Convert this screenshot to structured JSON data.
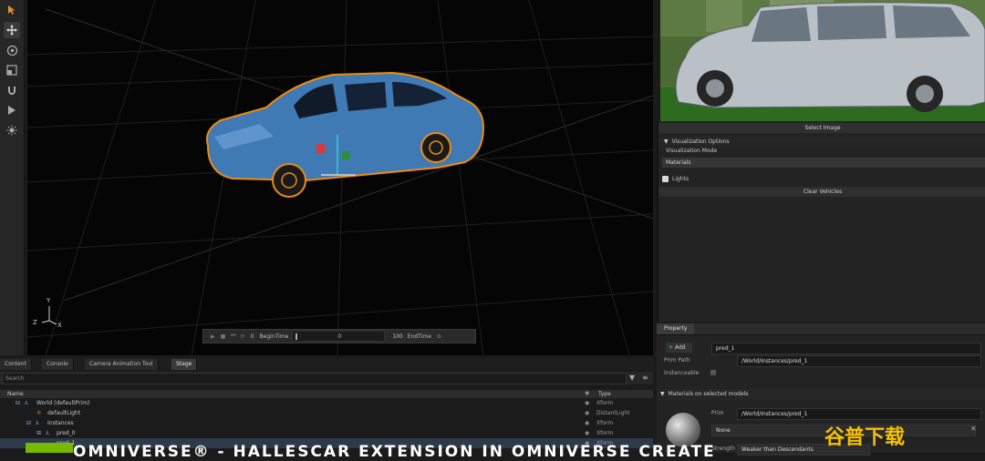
{
  "toolbar": {
    "tools": [
      "select-arrow-icon",
      "move-icon",
      "rotate-icon",
      "scale-icon",
      "snap-magnet-icon",
      "play-icon",
      "light-icon"
    ]
  },
  "viewport": {
    "axis_y": "Y",
    "axis_z": "Z",
    "axis_x": "X"
  },
  "timeline": {
    "start_value": "0",
    "begin_label": "BeginTime",
    "current_value": "0",
    "end_value": "100",
    "end_label": "EndTime"
  },
  "right_panel": {
    "select_image_label": "Select Image",
    "visualization_options_label": "Visualization Options",
    "visualization_mode_label": "Visualization Mode",
    "visualization_mode_value": "Materials",
    "lights_label": "Lights",
    "clear_vehicles_label": "Clear Vehicles"
  },
  "property_panel": {
    "tab_label": "Property",
    "add_label": "Add",
    "name_value": "pred_1",
    "prim_path_label": "Prim Path",
    "prim_path_value": "/World/Instances/pred_1",
    "instanceable_label": "Instanceable",
    "materials_section_label": "Materials on selected models",
    "prim_label": "Prim",
    "prim_value": "/World/Instances/pred_1",
    "material_value": "None",
    "strength_label": "Strength",
    "strength_value": "Weaker than Descendants"
  },
  "bottom_panel": {
    "tabs": [
      "Content",
      "Console",
      "Camera Animation Tool",
      "Stage"
    ],
    "search_placeholder": "Search",
    "col_name": "Name",
    "col_type": "Type",
    "rows": [
      {
        "name": "World (defaultPrim)",
        "type": "Xform"
      },
      {
        "name": "defaultLight",
        "type": "DistantLight"
      },
      {
        "name": "Instances",
        "type": "Xform"
      },
      {
        "name": "pred_0",
        "type": "Xform"
      },
      {
        "name": "pred_1",
        "type": "Xform"
      }
    ]
  },
  "banner_text": "OMNIVERSE® - HALLESCAR EXTENSION IN OMNIVERSE CREATE",
  "watermark_text": "谷普下载"
}
